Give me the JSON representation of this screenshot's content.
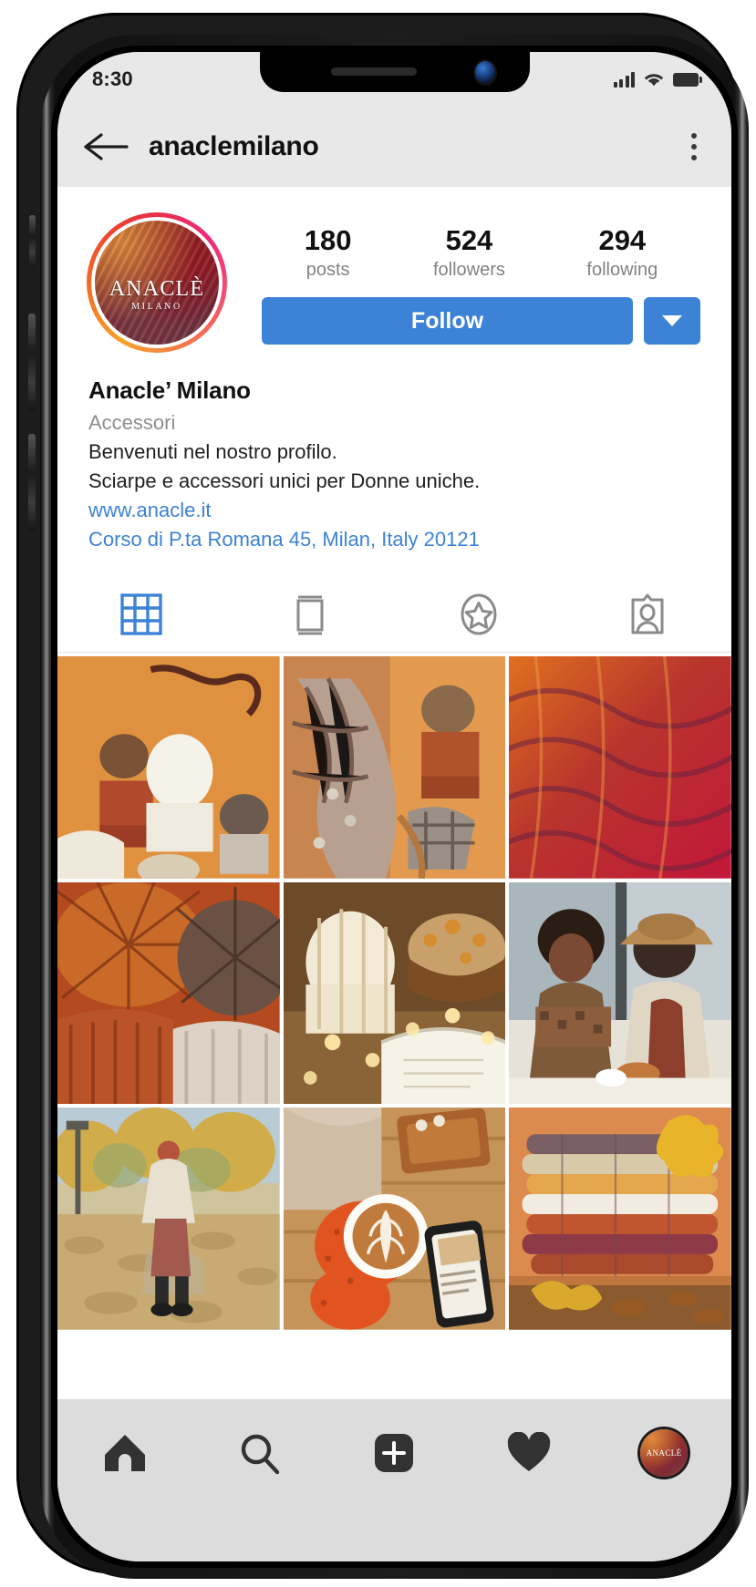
{
  "status_bar": {
    "time": "8:30",
    "signal_icon": "cellular-signal-icon",
    "wifi_icon": "wifi-icon",
    "battery_icon": "battery-icon"
  },
  "header": {
    "back_icon": "back-arrow-icon",
    "title": "anaclemilano",
    "overflow_icon": "overflow-menu-icon"
  },
  "profile": {
    "avatar": {
      "logo_main": "ANACLÈ",
      "logo_sub": "MILANO",
      "has_story_ring": true
    },
    "stats": [
      {
        "value": "180",
        "label": "posts"
      },
      {
        "value": "524",
        "label": "followers"
      },
      {
        "value": "294",
        "label": "following"
      }
    ],
    "follow_button": "Follow",
    "dropdown_icon": "chevron-down-icon",
    "name": "Anacle’ Milano",
    "category": "Accessori",
    "bio_lines": [
      "Benvenuti nel nostro profilo.",
      "Sciarpe e accessori unici per Donne uniche."
    ],
    "website": "www.anacle.it",
    "address": "Corso di P.ta Romana 45, Milan, Italy 20121"
  },
  "tabs": [
    {
      "name": "grid-tab",
      "icon": "grid-icon",
      "active": true
    },
    {
      "name": "reels-tab",
      "icon": "reels-icon",
      "active": false
    },
    {
      "name": "highlights-tab",
      "icon": "star-circle-icon",
      "active": false
    },
    {
      "name": "tagged-tab",
      "icon": "tagged-person-icon",
      "active": false
    }
  ],
  "grid": [
    {
      "alt": "knit beanies with fur pompoms on orange background"
    },
    {
      "alt": "plaid scarf with beanie and tan leather handbag"
    },
    {
      "alt": "red and orange mohair scarf texture close-up"
    },
    {
      "alt": "fur pompom beanie close-up in rust and grey"
    },
    {
      "alt": "white knit beanie with fairy lights and open book"
    },
    {
      "alt": "two women with scarf and hat at a cafe"
    },
    {
      "alt": "woman walking in autumn park with fallen leaves"
    },
    {
      "alt": "hands in orange gloves holding latte near phone"
    },
    {
      "alt": "stack of folded scarves with yellow maple leaf"
    }
  ],
  "bottom_nav": [
    {
      "name": "nav-home",
      "icon": "home-icon"
    },
    {
      "name": "nav-search",
      "icon": "search-icon"
    },
    {
      "name": "nav-add",
      "icon": "add-post-icon"
    },
    {
      "name": "nav-activity",
      "icon": "heart-icon"
    },
    {
      "name": "nav-profile",
      "icon": "profile-avatar-icon"
    }
  ],
  "colors": {
    "accent_blue": "#3c82d6",
    "header_bg": "#e8e8e8",
    "nav_bg": "#dcdcdc",
    "muted_text": "#8e8e8e"
  }
}
